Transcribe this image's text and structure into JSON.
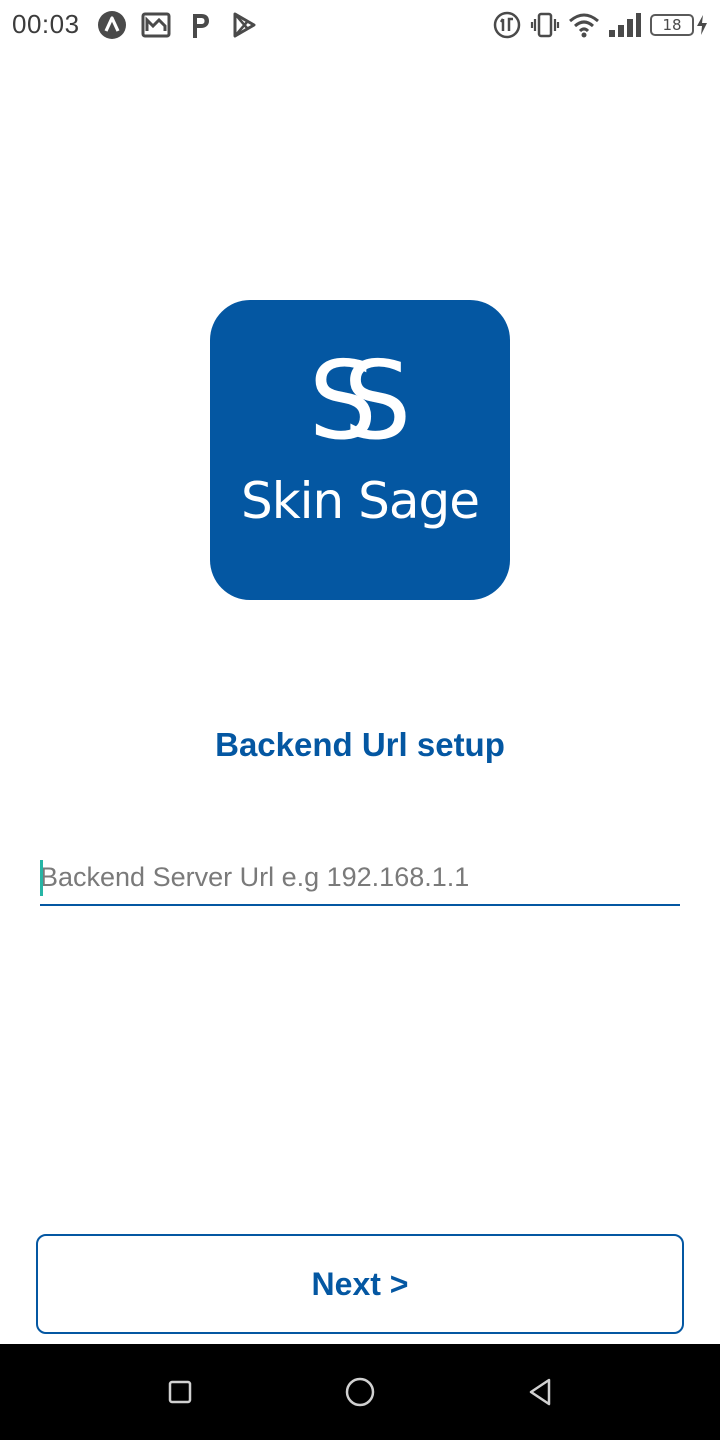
{
  "status_bar": {
    "time": "00:03",
    "battery_level": "18",
    "left_icons": [
      "app-a-icon",
      "gallery-icon",
      "paypal-icon",
      "play-store-icon"
    ],
    "right_icons": [
      "data-icon",
      "vibrate-icon",
      "wifi-icon",
      "signal-icon",
      "battery-icon",
      "charging-icon"
    ]
  },
  "logo": {
    "mark": "SS",
    "name": "Skin Sage",
    "color": "#0457a2"
  },
  "setup": {
    "title": "Backend Url setup",
    "input_placeholder": "Backend Server Url e.g 192.168.1.1",
    "input_value": ""
  },
  "actions": {
    "next_label": "Next >"
  },
  "nav_bar": {
    "buttons": [
      "recents-button",
      "home-button",
      "back-button"
    ]
  },
  "colors": {
    "accent": "#0457a2",
    "caret": "#26b5a5",
    "nav_background": "#000000"
  }
}
